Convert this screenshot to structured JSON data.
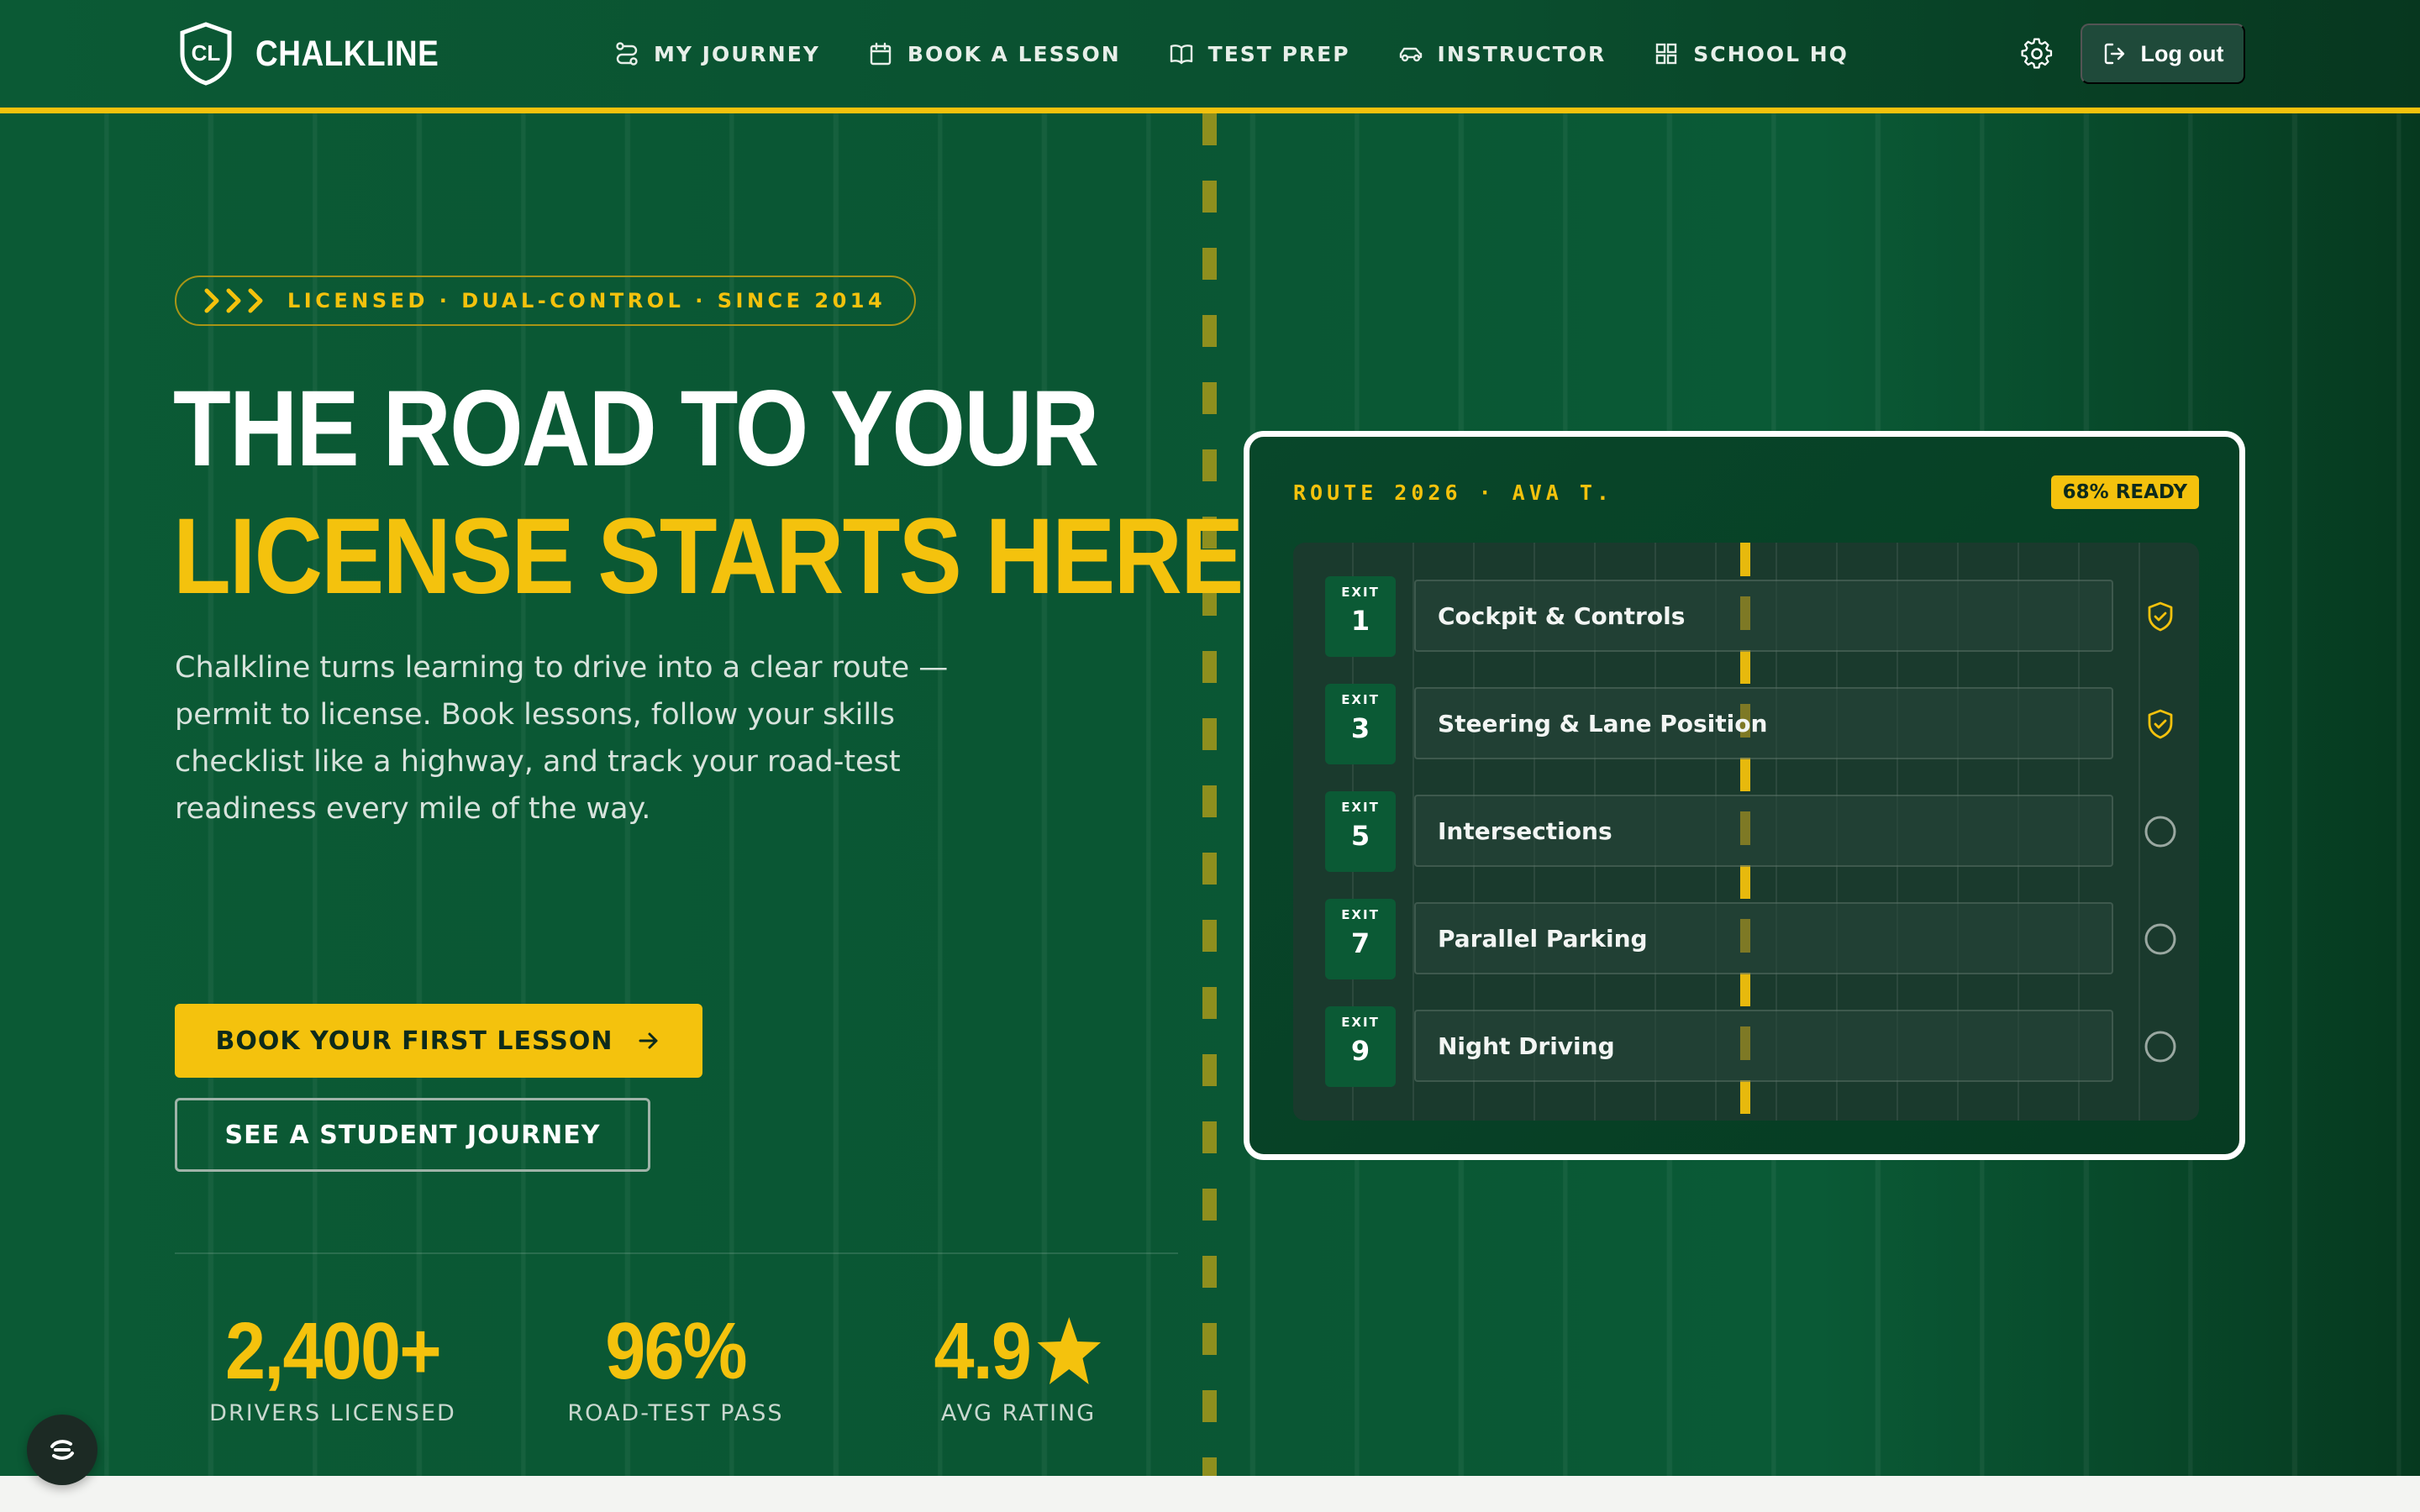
{
  "brand": {
    "monogram": "CL",
    "name": "CHALKLINE"
  },
  "nav": [
    {
      "label": "MY JOURNEY",
      "icon": "route-icon"
    },
    {
      "label": "BOOK A LESSON",
      "icon": "calendar-icon"
    },
    {
      "label": "TEST PREP",
      "icon": "book-icon"
    },
    {
      "label": "INSTRUCTOR",
      "icon": "car-icon"
    },
    {
      "label": "SCHOOL HQ",
      "icon": "grid-icon"
    }
  ],
  "header": {
    "settings_icon": "gear-icon",
    "logout_label": "Log out"
  },
  "hero": {
    "tagline": "LICENSED · DUAL-CONTROL · SINCE 2014",
    "headline_line1": "THE ROAD TO YOUR",
    "headline_line2": "LICENSE STARTS HERE",
    "lead": "Chalkline turns learning to drive into a clear route — permit to license. Book lessons, follow your skills checklist like a highway, and track your road-test readiness every mile of the way.",
    "primary_cta": "BOOK YOUR FIRST LESSON",
    "secondary_cta": "SEE A STUDENT JOURNEY"
  },
  "stats": [
    {
      "value": "2,400+",
      "label": "DRIVERS LICENSED"
    },
    {
      "value": "96%",
      "label": "ROAD-TEST PASS"
    },
    {
      "value": "4.9",
      "label": "AVG RATING",
      "icon": "star-icon"
    }
  ],
  "route_card": {
    "title": "ROUTE 2026 · AVA T.",
    "readiness_badge": "68% READY",
    "exit_label": "EXIT",
    "lessons": [
      {
        "exit": "1",
        "name": "Cockpit & Controls",
        "status": "complete"
      },
      {
        "exit": "3",
        "name": "Steering & Lane Position",
        "status": "complete"
      },
      {
        "exit": "5",
        "name": "Intersections",
        "status": "pending"
      },
      {
        "exit": "7",
        "name": "Parallel Parking",
        "status": "pending"
      },
      {
        "exit": "9",
        "name": "Night Driving",
        "status": "pending"
      }
    ]
  },
  "colors": {
    "brand_green": "#0b5a35",
    "accent_yellow": "#f4c20d",
    "dark_green": "#06391f"
  }
}
